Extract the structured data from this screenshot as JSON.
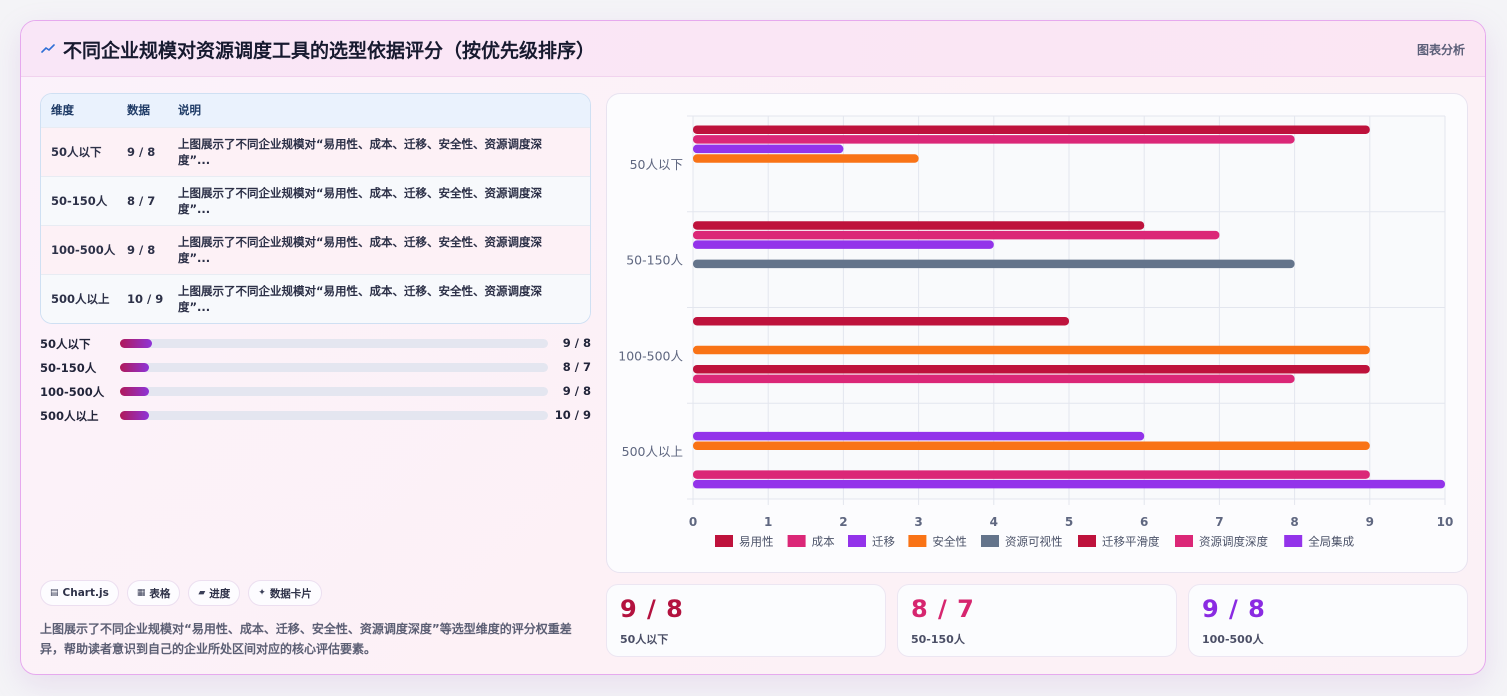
{
  "header": {
    "title": "不同企业规模对资源调度工具的选型依据评分（按优先级排序）",
    "tag": "图表分析"
  },
  "table": {
    "headers": [
      "维度",
      "数据",
      "说明"
    ],
    "rows": [
      {
        "dim": "50人以下",
        "data": "9 / 8",
        "desc": "上图展示了不同企业规模对“易用性、成本、迁移、安全性、资源调度深度”..."
      },
      {
        "dim": "50-150人",
        "data": "8 / 7",
        "desc": "上图展示了不同企业规模对“易用性、成本、迁移、安全性、资源调度深度”..."
      },
      {
        "dim": "100-500人",
        "data": "9 / 8",
        "desc": "上图展示了不同企业规模对“易用性、成本、迁移、安全性、资源调度深度”..."
      },
      {
        "dim": "500人以上",
        "data": "10 / 9",
        "desc": "上图展示了不同企业规模对“易用性、成本、迁移、安全性、资源调度深度”..."
      }
    ]
  },
  "progress": [
    {
      "label": "50人以下",
      "value": "9 / 8",
      "fill": 0.075
    },
    {
      "label": "50-150人",
      "value": "8 / 7",
      "fill": 0.068
    },
    {
      "label": "100-500人",
      "value": "9 / 8",
      "fill": 0.068
    },
    {
      "label": "500人以上",
      "value": "10 / 9",
      "fill": 0.068
    }
  ],
  "chips": [
    {
      "icon": "▤",
      "label": "Chart.js"
    },
    {
      "icon": "▦",
      "label": "表格"
    },
    {
      "icon": "▰",
      "label": "进度"
    },
    {
      "icon": "✦",
      "label": "数据卡片"
    }
  ],
  "summary": "上图展示了不同企业规模对“易用性、成本、迁移、安全性、资源调度深度”等选型维度的评分权重差异，帮助读者意识到自己的企业所处区间对应的核心评估要素。",
  "kpis": [
    {
      "value": "9 / 8",
      "label": "50人以下",
      "color": "#b3123f"
    },
    {
      "value": "8 / 7",
      "label": "50-150人",
      "color": "#d6266f"
    },
    {
      "value": "9 / 8",
      "label": "100-500人",
      "color": "#8a2be2"
    }
  ],
  "chart_data": {
    "type": "bar",
    "orientation": "horizontal",
    "categories": [
      "50人以下",
      "50-150人",
      "100-500人",
      "500人以上"
    ],
    "xlim": [
      0,
      10
    ],
    "xticks": [
      0,
      1,
      2,
      3,
      4,
      5,
      6,
      7,
      8,
      9,
      10
    ],
    "grid": true,
    "legend_position": "bottom",
    "series": [
      {
        "name": "易用性",
        "color": "#be123c",
        "values": [
          9,
          6,
          5,
          null
        ]
      },
      {
        "name": "成本",
        "color": "#db2777",
        "values": [
          8,
          7,
          null,
          null
        ]
      },
      {
        "name": "迁移",
        "color": "#9333ea",
        "values": [
          2,
          4,
          null,
          6
        ]
      },
      {
        "name": "安全性",
        "color": "#f97316",
        "values": [
          3,
          null,
          9,
          9
        ]
      },
      {
        "name": "资源可视性",
        "color": "#64748b",
        "values": [
          null,
          8,
          null,
          null
        ]
      },
      {
        "name": "迁移平滑度",
        "color": "#be123c",
        "values": [
          null,
          null,
          9,
          null
        ]
      },
      {
        "name": "资源调度深度",
        "color": "#db2777",
        "values": [
          null,
          null,
          8,
          9
        ]
      },
      {
        "name": "全局集成",
        "color": "#9333ea",
        "values": [
          null,
          null,
          null,
          10
        ]
      }
    ]
  }
}
